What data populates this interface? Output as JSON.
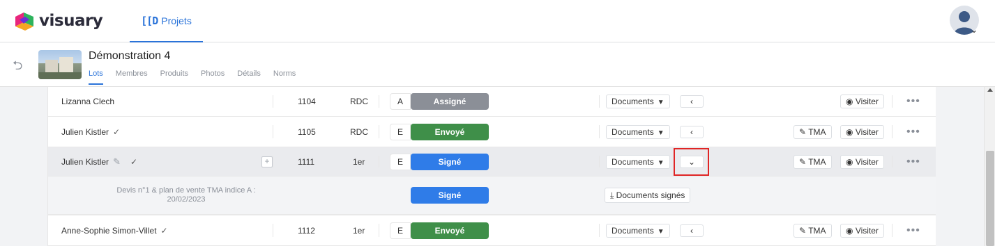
{
  "app": {
    "brand": "visuary",
    "nav_tab": "Projets"
  },
  "project": {
    "title": "Démonstration 4",
    "tabs": [
      "Lots",
      "Membres",
      "Produits",
      "Photos",
      "Détails",
      "Norms"
    ],
    "active_tab": "Lots"
  },
  "colors": {
    "assigned": "#8b8f97",
    "sent": "#3f8f49",
    "signed": "#2f7ce8",
    "accent": "#2a73d9"
  },
  "rows": [
    {
      "name": "Lizanna Clech",
      "check": "",
      "lot": "1104",
      "floor": "RDC",
      "letter": "A",
      "status": "Assigné",
      "documents": "Documents",
      "tma": "",
      "visit": "Visiter"
    },
    {
      "name": "Julien Kistler",
      "check": "✓",
      "lot": "1105",
      "floor": "RDC",
      "letter": "E",
      "status": "Envoyé",
      "documents": "Documents",
      "tma": "TMA",
      "visit": "Visiter"
    },
    {
      "name": "Julien Kistler",
      "check": "✓",
      "lot": "1111",
      "floor": "1er",
      "letter": "E",
      "status": "Signé",
      "documents": "Documents",
      "tma": "TMA",
      "visit": "Visiter"
    },
    {
      "name": "Anne-Sophie Simon-Villet",
      "check": "✓",
      "lot": "1112",
      "floor": "1er",
      "letter": "E",
      "status": "Envoyé",
      "documents": "Documents",
      "tma": "TMA",
      "visit": "Visiter"
    }
  ],
  "detail": {
    "text_line1": "Devis n°1 & plan de vente TMA indice A :",
    "text_line2": "20/02/2023",
    "status": "Signé",
    "download_label": "Documents signés"
  }
}
